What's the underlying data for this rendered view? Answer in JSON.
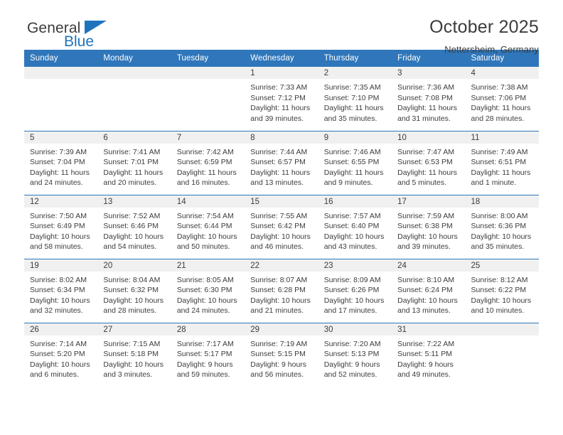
{
  "brand": {
    "name_top": "General",
    "name_bottom": "Blue",
    "triangle_color": "#1f73bd"
  },
  "header": {
    "title": "October 2025",
    "subtitle": "Nettersheim, Germany",
    "header_bg": "#2f76ba",
    "header_text_color": "#ffffff",
    "daynum_bg": "#f0f0f0"
  },
  "weekday_headers": [
    "Sunday",
    "Monday",
    "Tuesday",
    "Wednesday",
    "Thursday",
    "Friday",
    "Saturday"
  ],
  "labels": {
    "sunrise": "Sunrise:",
    "sunset": "Sunset:",
    "daylight": "Daylight:"
  },
  "weeks": [
    [
      {
        "day": "",
        "blank": true,
        "sunrise": "",
        "sunset": "",
        "daylight_1": "",
        "daylight_2": ""
      },
      {
        "day": "",
        "blank": true,
        "sunrise": "",
        "sunset": "",
        "daylight_1": "",
        "daylight_2": ""
      },
      {
        "day": "",
        "blank": true,
        "sunrise": "",
        "sunset": "",
        "daylight_1": "",
        "daylight_2": ""
      },
      {
        "day": "1",
        "blank": false,
        "sunrise": "Sunrise: 7:33 AM",
        "sunset": "Sunset: 7:12 PM",
        "daylight_1": "Daylight: 11 hours",
        "daylight_2": "and 39 minutes."
      },
      {
        "day": "2",
        "blank": false,
        "sunrise": "Sunrise: 7:35 AM",
        "sunset": "Sunset: 7:10 PM",
        "daylight_1": "Daylight: 11 hours",
        "daylight_2": "and 35 minutes."
      },
      {
        "day": "3",
        "blank": false,
        "sunrise": "Sunrise: 7:36 AM",
        "sunset": "Sunset: 7:08 PM",
        "daylight_1": "Daylight: 11 hours",
        "daylight_2": "and 31 minutes."
      },
      {
        "day": "4",
        "blank": false,
        "sunrise": "Sunrise: 7:38 AM",
        "sunset": "Sunset: 7:06 PM",
        "daylight_1": "Daylight: 11 hours",
        "daylight_2": "and 28 minutes."
      }
    ],
    [
      {
        "day": "5",
        "blank": false,
        "sunrise": "Sunrise: 7:39 AM",
        "sunset": "Sunset: 7:04 PM",
        "daylight_1": "Daylight: 11 hours",
        "daylight_2": "and 24 minutes."
      },
      {
        "day": "6",
        "blank": false,
        "sunrise": "Sunrise: 7:41 AM",
        "sunset": "Sunset: 7:01 PM",
        "daylight_1": "Daylight: 11 hours",
        "daylight_2": "and 20 minutes."
      },
      {
        "day": "7",
        "blank": false,
        "sunrise": "Sunrise: 7:42 AM",
        "sunset": "Sunset: 6:59 PM",
        "daylight_1": "Daylight: 11 hours",
        "daylight_2": "and 16 minutes."
      },
      {
        "day": "8",
        "blank": false,
        "sunrise": "Sunrise: 7:44 AM",
        "sunset": "Sunset: 6:57 PM",
        "daylight_1": "Daylight: 11 hours",
        "daylight_2": "and 13 minutes."
      },
      {
        "day": "9",
        "blank": false,
        "sunrise": "Sunrise: 7:46 AM",
        "sunset": "Sunset: 6:55 PM",
        "daylight_1": "Daylight: 11 hours",
        "daylight_2": "and 9 minutes."
      },
      {
        "day": "10",
        "blank": false,
        "sunrise": "Sunrise: 7:47 AM",
        "sunset": "Sunset: 6:53 PM",
        "daylight_1": "Daylight: 11 hours",
        "daylight_2": "and 5 minutes."
      },
      {
        "day": "11",
        "blank": false,
        "sunrise": "Sunrise: 7:49 AM",
        "sunset": "Sunset: 6:51 PM",
        "daylight_1": "Daylight: 11 hours",
        "daylight_2": "and 1 minute."
      }
    ],
    [
      {
        "day": "12",
        "blank": false,
        "sunrise": "Sunrise: 7:50 AM",
        "sunset": "Sunset: 6:49 PM",
        "daylight_1": "Daylight: 10 hours",
        "daylight_2": "and 58 minutes."
      },
      {
        "day": "13",
        "blank": false,
        "sunrise": "Sunrise: 7:52 AM",
        "sunset": "Sunset: 6:46 PM",
        "daylight_1": "Daylight: 10 hours",
        "daylight_2": "and 54 minutes."
      },
      {
        "day": "14",
        "blank": false,
        "sunrise": "Sunrise: 7:54 AM",
        "sunset": "Sunset: 6:44 PM",
        "daylight_1": "Daylight: 10 hours",
        "daylight_2": "and 50 minutes."
      },
      {
        "day": "15",
        "blank": false,
        "sunrise": "Sunrise: 7:55 AM",
        "sunset": "Sunset: 6:42 PM",
        "daylight_1": "Daylight: 10 hours",
        "daylight_2": "and 46 minutes."
      },
      {
        "day": "16",
        "blank": false,
        "sunrise": "Sunrise: 7:57 AM",
        "sunset": "Sunset: 6:40 PM",
        "daylight_1": "Daylight: 10 hours",
        "daylight_2": "and 43 minutes."
      },
      {
        "day": "17",
        "blank": false,
        "sunrise": "Sunrise: 7:59 AM",
        "sunset": "Sunset: 6:38 PM",
        "daylight_1": "Daylight: 10 hours",
        "daylight_2": "and 39 minutes."
      },
      {
        "day": "18",
        "blank": false,
        "sunrise": "Sunrise: 8:00 AM",
        "sunset": "Sunset: 6:36 PM",
        "daylight_1": "Daylight: 10 hours",
        "daylight_2": "and 35 minutes."
      }
    ],
    [
      {
        "day": "19",
        "blank": false,
        "sunrise": "Sunrise: 8:02 AM",
        "sunset": "Sunset: 6:34 PM",
        "daylight_1": "Daylight: 10 hours",
        "daylight_2": "and 32 minutes."
      },
      {
        "day": "20",
        "blank": false,
        "sunrise": "Sunrise: 8:04 AM",
        "sunset": "Sunset: 6:32 PM",
        "daylight_1": "Daylight: 10 hours",
        "daylight_2": "and 28 minutes."
      },
      {
        "day": "21",
        "blank": false,
        "sunrise": "Sunrise: 8:05 AM",
        "sunset": "Sunset: 6:30 PM",
        "daylight_1": "Daylight: 10 hours",
        "daylight_2": "and 24 minutes."
      },
      {
        "day": "22",
        "blank": false,
        "sunrise": "Sunrise: 8:07 AM",
        "sunset": "Sunset: 6:28 PM",
        "daylight_1": "Daylight: 10 hours",
        "daylight_2": "and 21 minutes."
      },
      {
        "day": "23",
        "blank": false,
        "sunrise": "Sunrise: 8:09 AM",
        "sunset": "Sunset: 6:26 PM",
        "daylight_1": "Daylight: 10 hours",
        "daylight_2": "and 17 minutes."
      },
      {
        "day": "24",
        "blank": false,
        "sunrise": "Sunrise: 8:10 AM",
        "sunset": "Sunset: 6:24 PM",
        "daylight_1": "Daylight: 10 hours",
        "daylight_2": "and 13 minutes."
      },
      {
        "day": "25",
        "blank": false,
        "sunrise": "Sunrise: 8:12 AM",
        "sunset": "Sunset: 6:22 PM",
        "daylight_1": "Daylight: 10 hours",
        "daylight_2": "and 10 minutes."
      }
    ],
    [
      {
        "day": "26",
        "blank": false,
        "sunrise": "Sunrise: 7:14 AM",
        "sunset": "Sunset: 5:20 PM",
        "daylight_1": "Daylight: 10 hours",
        "daylight_2": "and 6 minutes."
      },
      {
        "day": "27",
        "blank": false,
        "sunrise": "Sunrise: 7:15 AM",
        "sunset": "Sunset: 5:18 PM",
        "daylight_1": "Daylight: 10 hours",
        "daylight_2": "and 3 minutes."
      },
      {
        "day": "28",
        "blank": false,
        "sunrise": "Sunrise: 7:17 AM",
        "sunset": "Sunset: 5:17 PM",
        "daylight_1": "Daylight: 9 hours",
        "daylight_2": "and 59 minutes."
      },
      {
        "day": "29",
        "blank": false,
        "sunrise": "Sunrise: 7:19 AM",
        "sunset": "Sunset: 5:15 PM",
        "daylight_1": "Daylight: 9 hours",
        "daylight_2": "and 56 minutes."
      },
      {
        "day": "30",
        "blank": false,
        "sunrise": "Sunrise: 7:20 AM",
        "sunset": "Sunset: 5:13 PM",
        "daylight_1": "Daylight: 9 hours",
        "daylight_2": "and 52 minutes."
      },
      {
        "day": "31",
        "blank": false,
        "sunrise": "Sunrise: 7:22 AM",
        "sunset": "Sunset: 5:11 PM",
        "daylight_1": "Daylight: 9 hours",
        "daylight_2": "and 49 minutes."
      },
      {
        "day": "",
        "blank": true,
        "sunrise": "",
        "sunset": "",
        "daylight_1": "",
        "daylight_2": ""
      }
    ]
  ]
}
